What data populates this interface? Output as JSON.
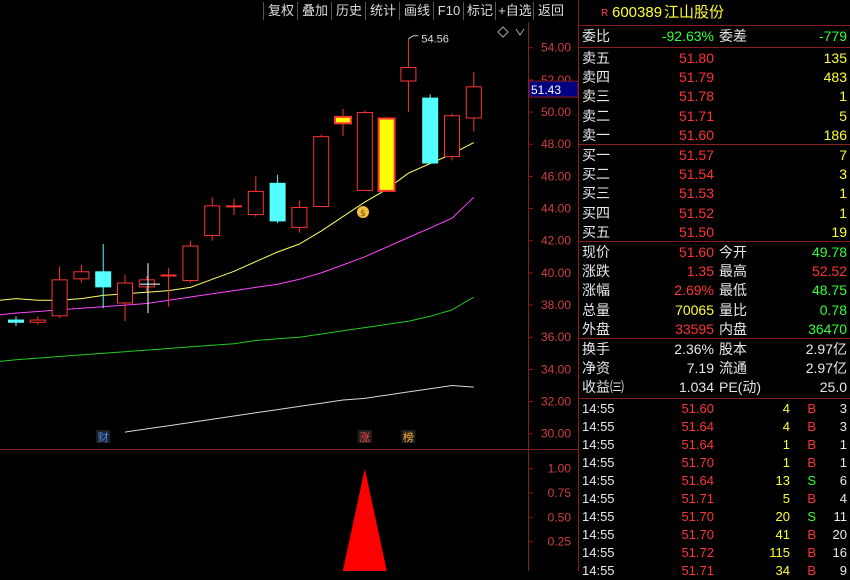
{
  "toolbar": {
    "buttons": [
      "复权",
      "叠加",
      "历史",
      "统计",
      "画线",
      "F10",
      "标记",
      "+自选",
      "返回"
    ]
  },
  "chart_data": {
    "type": "candlestick",
    "candles": [
      {
        "o": 37.1,
        "h": 37.3,
        "l": 36.7,
        "c": 36.9
      },
      {
        "o": 36.9,
        "h": 37.3,
        "l": 36.8,
        "c": 37.1
      },
      {
        "o": 37.3,
        "h": 40.4,
        "l": 37.2,
        "c": 39.6
      },
      {
        "o": 39.6,
        "h": 40.5,
        "l": 39.4,
        "c": 40.1
      },
      {
        "o": 40.1,
        "h": 41.8,
        "l": 37.8,
        "c": 39.1
      },
      {
        "o": 38.1,
        "h": 39.9,
        "l": 37.0,
        "c": 39.4
      },
      {
        "o": 39.1,
        "h": 39.8,
        "l": 38.8,
        "c": 39.6
      },
      {
        "o": 39.8,
        "h": 40.3,
        "l": 37.9,
        "c": 39.9
      },
      {
        "o": 39.5,
        "h": 42.0,
        "l": 39.4,
        "c": 41.7
      },
      {
        "o": 42.3,
        "h": 44.7,
        "l": 42.0,
        "c": 44.2
      },
      {
        "o": 44.1,
        "h": 44.6,
        "l": 43.6,
        "c": 44.2
      },
      {
        "o": 43.6,
        "h": 46.0,
        "l": 43.5,
        "c": 45.1
      },
      {
        "o": 45.6,
        "h": 46.1,
        "l": 43.1,
        "c": 43.2
      },
      {
        "o": 42.8,
        "h": 44.5,
        "l": 42.5,
        "c": 44.1
      },
      {
        "o": 44.1,
        "h": 48.6,
        "l": 44.1,
        "c": 48.5
      },
      {
        "o": 49.3,
        "h": 50.2,
        "l": 48.5,
        "c": 49.7
      },
      {
        "o": 45.1,
        "h": 50.1,
        "l": 45.1,
        "c": 50.0
      },
      {
        "o": 45.1,
        "h": 49.7,
        "l": 45.1,
        "c": 49.6
      },
      {
        "o": 51.9,
        "h": 54.56,
        "l": 50.0,
        "c": 52.8
      },
      {
        "o": 50.9,
        "h": 51.1,
        "l": 46.8,
        "c": 46.8
      },
      {
        "o": 47.2,
        "h": 49.9,
        "l": 47.0,
        "c": 49.8
      },
      {
        "o": 49.6,
        "h": 52.5,
        "l": 48.8,
        "c": 51.6
      }
    ],
    "ma": [
      {
        "color": "#ffff66",
        "values": [
          38.4,
          38.3,
          38.3,
          38.4,
          38.6,
          38.7,
          38.8,
          38.9,
          39.1,
          39.6,
          40.1,
          40.7,
          41.3,
          41.8,
          42.6,
          43.5,
          44.4,
          45.2,
          46.2,
          46.8,
          47.4,
          48.1
        ]
      },
      {
        "color": "#ff44ff",
        "values": [
          37.5,
          37.6,
          37.7,
          37.8,
          37.9,
          38.0,
          38.1,
          38.3,
          38.5,
          38.7,
          38.9,
          39.1,
          39.3,
          39.6,
          40.0,
          40.5,
          41.0,
          41.6,
          42.2,
          42.8,
          43.4,
          44.7
        ]
      },
      {
        "color": "#22cc22",
        "values": [
          34.6,
          34.7,
          34.8,
          34.9,
          35.0,
          35.1,
          35.2,
          35.3,
          35.4,
          35.5,
          35.6,
          35.8,
          35.9,
          36.0,
          36.2,
          36.4,
          36.6,
          36.8,
          37.0,
          37.3,
          37.7,
          38.5
        ]
      },
      {
        "color": "#d8d8d8",
        "values": [
          null,
          null,
          null,
          null,
          null,
          30.1,
          30.3,
          30.5,
          30.7,
          30.9,
          31.1,
          31.3,
          31.5,
          31.7,
          31.9,
          32.1,
          32.2,
          32.4,
          32.6,
          32.8,
          33.0,
          32.9
        ]
      }
    ],
    "ylim": [
      29.3,
      55.6
    ],
    "yticks": [
      "54.00",
      "52.00",
      "50.00",
      "48.00",
      "46.00",
      "44.00",
      "42.00",
      "40.00",
      "38.00",
      "36.00",
      "34.00",
      "32.00",
      "30.00"
    ],
    "current_price": "51.43",
    "high_label": "54.56",
    "markers": [
      {
        "text": "财",
        "color": "#4488ff",
        "index": 4
      },
      {
        "text": "涨",
        "color": "#ff4444",
        "index": 16
      },
      {
        "text": "榜",
        "color": "#ffaa33",
        "index": 18
      }
    ],
    "indicator": {
      "yticks": [
        "1.00",
        "0.75",
        "0.50",
        "0.25"
      ],
      "ylim": [
        0,
        1.15
      ],
      "signal_index": 16,
      "value": 1.0
    }
  },
  "quote": {
    "code": "600389",
    "name": "江山股份",
    "flag": "R",
    "webi_label": "委比",
    "webi": "-92.63%",
    "weicha_label": "委差",
    "weicha": "-779",
    "asks": [
      {
        "label": "卖五",
        "price": "51.80",
        "vol": "135"
      },
      {
        "label": "卖四",
        "price": "51.79",
        "vol": "483"
      },
      {
        "label": "卖三",
        "price": "51.78",
        "vol": "1"
      },
      {
        "label": "卖二",
        "price": "51.71",
        "vol": "5"
      },
      {
        "label": "卖一",
        "price": "51.60",
        "vol": "186"
      }
    ],
    "bids": [
      {
        "label": "买一",
        "price": "51.57",
        "vol": "7"
      },
      {
        "label": "买二",
        "price": "51.54",
        "vol": "3"
      },
      {
        "label": "买三",
        "price": "51.53",
        "vol": "1"
      },
      {
        "label": "买四",
        "price": "51.52",
        "vol": "1"
      },
      {
        "label": "买五",
        "price": "51.50",
        "vol": "19"
      }
    ],
    "stats": [
      {
        "l1": "现价",
        "v1": "51.60",
        "c1": "red",
        "l2": "今开",
        "v2": "49.78",
        "c2": "green"
      },
      {
        "l1": "涨跌",
        "v1": "1.35",
        "c1": "red",
        "l2": "最高",
        "v2": "52.52",
        "c2": "red"
      },
      {
        "l1": "涨幅",
        "v1": "2.69%",
        "c1": "red",
        "l2": "最低",
        "v2": "48.75",
        "c2": "green"
      },
      {
        "l1": "总量",
        "v1": "70065",
        "c1": "yellow",
        "l2": "量比",
        "v2": "0.78",
        "c2": "green"
      },
      {
        "l1": "外盘",
        "v1": "33595",
        "c1": "red",
        "l2": "内盘",
        "v2": "36470",
        "c2": "green"
      }
    ],
    "stats2": [
      {
        "l1": "换手",
        "v1": "2.36%",
        "c1": "white",
        "l2": "股本",
        "v2": "2.97亿",
        "c2": "white"
      },
      {
        "l1": "净资",
        "v1": "7.19",
        "c1": "white",
        "l2": "流通",
        "v2": "2.97亿",
        "c2": "white"
      },
      {
        "l1": "收益㈢",
        "v1": "1.034",
        "c1": "white",
        "l2": "PE(动)",
        "v2": "25.0",
        "c2": "white"
      }
    ],
    "ticks": [
      {
        "time": "14:55",
        "price": "51.60",
        "vol": "4",
        "side": "B",
        "n": "3"
      },
      {
        "time": "14:55",
        "price": "51.64",
        "vol": "4",
        "side": "B",
        "n": "3"
      },
      {
        "time": "14:55",
        "price": "51.64",
        "vol": "1",
        "side": "B",
        "n": "1"
      },
      {
        "time": "14:55",
        "price": "51.70",
        "vol": "1",
        "side": "B",
        "n": "1"
      },
      {
        "time": "14:55",
        "price": "51.64",
        "vol": "13",
        "side": "S",
        "n": "6"
      },
      {
        "time": "14:55",
        "price": "51.71",
        "vol": "5",
        "side": "B",
        "n": "4"
      },
      {
        "time": "14:55",
        "price": "51.70",
        "vol": "20",
        "side": "S",
        "n": "11"
      },
      {
        "time": "14:55",
        "price": "51.70",
        "vol": "41",
        "side": "B",
        "n": "20"
      },
      {
        "time": "14:55",
        "price": "51.72",
        "vol": "115",
        "side": "B",
        "n": "16"
      },
      {
        "time": "14:55",
        "price": "51.71",
        "vol": "34",
        "side": "B",
        "n": "9"
      }
    ]
  }
}
